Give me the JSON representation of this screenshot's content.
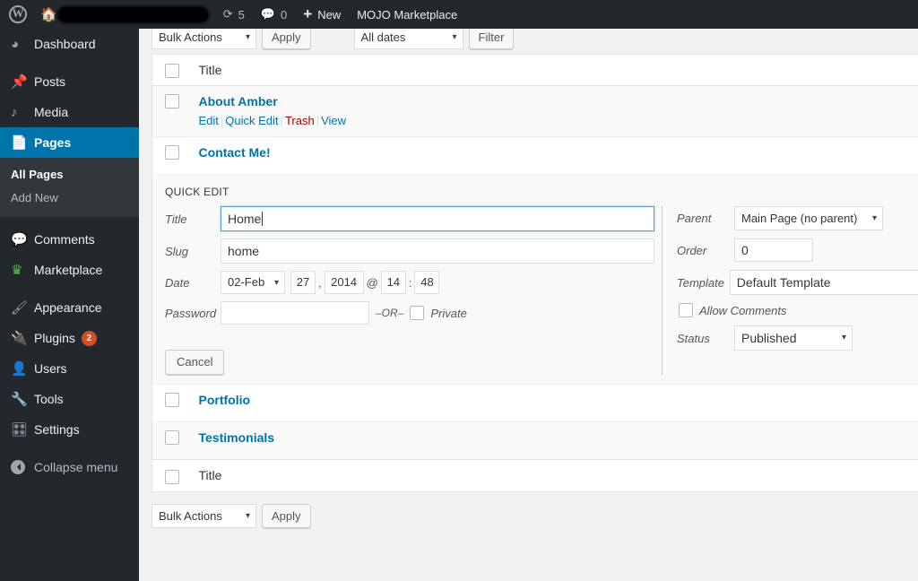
{
  "adminbar": {
    "wp_logo": "wordpress-logo",
    "home_icon": "home-icon",
    "site_name_redacted": "",
    "updates_icon": "updates-icon",
    "updates_count": "5",
    "comments_icon": "comment-bubble-icon",
    "comments_count": "0",
    "new_plus": "+",
    "new_label": "New",
    "marketplace_label": "MOJO Marketplace"
  },
  "sidebar": {
    "items": [
      {
        "label": "Dashboard",
        "icon": "dashboard-icon",
        "current": false
      },
      {
        "label": "Posts",
        "icon": "pin-icon",
        "current": false
      },
      {
        "label": "Media",
        "icon": "media-icon",
        "current": false
      },
      {
        "label": "Pages",
        "icon": "pages-icon",
        "current": true
      },
      {
        "label": "Comments",
        "icon": "comment-bubble-icon",
        "current": false
      },
      {
        "label": "Marketplace",
        "icon": "marketplace-icon",
        "current": false
      },
      {
        "label": "Appearance",
        "icon": "paintbrush-icon",
        "current": false
      },
      {
        "label": "Plugins",
        "icon": "plugin-icon",
        "current": false,
        "badge": "2"
      },
      {
        "label": "Users",
        "icon": "user-icon",
        "current": false
      },
      {
        "label": "Tools",
        "icon": "wrench-icon",
        "current": false
      },
      {
        "label": "Settings",
        "icon": "settings-sliders-icon",
        "current": false
      }
    ],
    "submenu": [
      {
        "label": "All Pages",
        "current": true
      },
      {
        "label": "Add New",
        "current": false
      }
    ],
    "collapse_label": "Collapse menu"
  },
  "tablenav_top": {
    "bulk_actions_value": "Bulk Actions",
    "apply_label": "Apply",
    "dates_value": "All dates",
    "filter_label": "Filter"
  },
  "tablenav_bottom": {
    "bulk_actions_value": "Bulk Actions",
    "apply_label": "Apply"
  },
  "table": {
    "column_title": "Title",
    "rows": [
      {
        "title": "About Amber",
        "actions": {
          "edit": "Edit",
          "quick_edit": "Quick Edit",
          "trash": "Trash",
          "view": "View"
        }
      },
      {
        "title": "Contact Me!"
      },
      {
        "title": "Portfolio"
      },
      {
        "title": "Testimonials"
      }
    ]
  },
  "quick_edit": {
    "legend": "QUICK EDIT",
    "labels": {
      "title": "Title",
      "slug": "Slug",
      "date": "Date",
      "password": "Password",
      "parent": "Parent",
      "order": "Order",
      "template": "Template",
      "allow_comments": "Allow Comments",
      "status": "Status"
    },
    "values": {
      "title": "Home",
      "slug": "home",
      "month": "02-Feb",
      "day": "27",
      "year": "2014",
      "hour": "14",
      "minute": "48",
      "password": "",
      "parent": "Main Page (no parent)",
      "order": "0",
      "template": "Default Template",
      "status": "Published"
    },
    "date_comma": ",",
    "date_at": "@",
    "date_colon": ":",
    "or_text": "–OR–",
    "private_label": "Private",
    "cancel_label": "Cancel"
  },
  "colors": {
    "admin_dark": "#23282d",
    "accent_blue": "#0073aa",
    "link_blue": "#0073aa",
    "trash_red": "#a00",
    "badge_orange": "#d54e21",
    "focus_blue": "#5b9dd9"
  }
}
